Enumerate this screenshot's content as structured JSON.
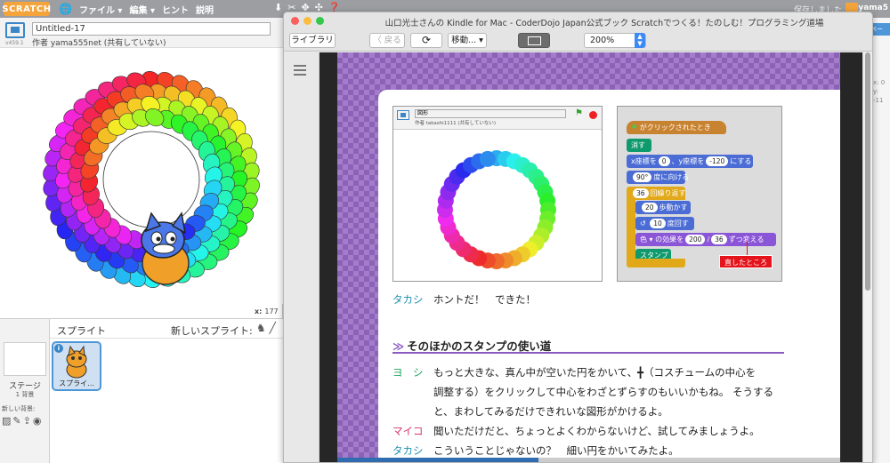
{
  "scratch": {
    "logo": "SCRATCH",
    "menu": [
      "ファイル ▾",
      "編集 ▾",
      "ヒント",
      "説明"
    ],
    "saved": "保存しました",
    "user": "yama5",
    "version": "v459.1",
    "project_title": "Untitled-17",
    "author": "作者 yama555net (共有していない)",
    "coord_x_label": "x:",
    "coord_x": "177",
    "sprites_title": "スプライト",
    "new_sprite": "新しいスプライト:",
    "stage_label": "ステージ",
    "stage_count": "1 背景",
    "new_backdrop": "新しい背景:",
    "sprite_name": "スプライ...",
    "right_button": "ペー",
    "right_coords": [
      "x: 0",
      "y: -11"
    ]
  },
  "kindle": {
    "title": "山口光士さんの Kindle for Mac - CoderDojo Japan公式ブック Scratchでつくる！たのしむ！プログラミング道場",
    "library_button": "ライブラリ",
    "back_button": "〈 戻る",
    "goto_button": "移動... ▾",
    "zoom": "200%",
    "progress": 0.4,
    "colors": {
      "page_purple": "#a37dc9",
      "heading_purple": "#8b5bc4",
      "speaker_blue": "#1a8fb0",
      "speaker_pink": "#d6336c",
      "speaker_green": "#1ea35a"
    }
  },
  "book": {
    "screenshot_title": "図形",
    "screenshot_author": "作者 takashi1111 (共有していない)",
    "script": {
      "hat": "がクリックされたとき",
      "clear": "消す",
      "goto_x_label": "x座標を",
      "goto_x": "0",
      "goto_y_label": "、y座標を",
      "goto_y": "-120",
      "goto_suffix": "にする",
      "point_value": "90°",
      "point_label": "度に向ける",
      "repeat_value": "36",
      "repeat_label": "回繰り返す",
      "move_value": "20",
      "move_label": "歩動かす",
      "turn_value": "10",
      "turn_label": "度回す",
      "effect_label": "色",
      "effect_mid": "の効果を",
      "effect_a": "200",
      "effect_op": "/",
      "effect_b": "36",
      "effect_suffix": "ずつ変える",
      "stamp": "スタンプ",
      "fixed_note": "直したところ"
    },
    "line1_speaker": "タカシ",
    "line1_text": "ホントだ！　できた！",
    "heading": "そのほかのスタンプの使い道",
    "heading_mark": "≫",
    "yoshi_speaker": "ヨ　シ",
    "yoshi_lines": [
      "もっと大きな、真ん中が空いた円をかいて、╋（コスチュームの中心を",
      "調整する）をクリックして中心をわざとずらすのもいいかもね。 そうする",
      "と、まわしてみるだけできれいな図形がかけるよ。"
    ],
    "maiko_speaker": "マイコ",
    "maiko_text": "聞いただけだと、ちょっとよくわからないけど、試してみましょうよ。",
    "takashi2_speaker": "タカシ",
    "takashi2_text": "こういうことじゃないの？　細い円をかいてみたよ。"
  }
}
